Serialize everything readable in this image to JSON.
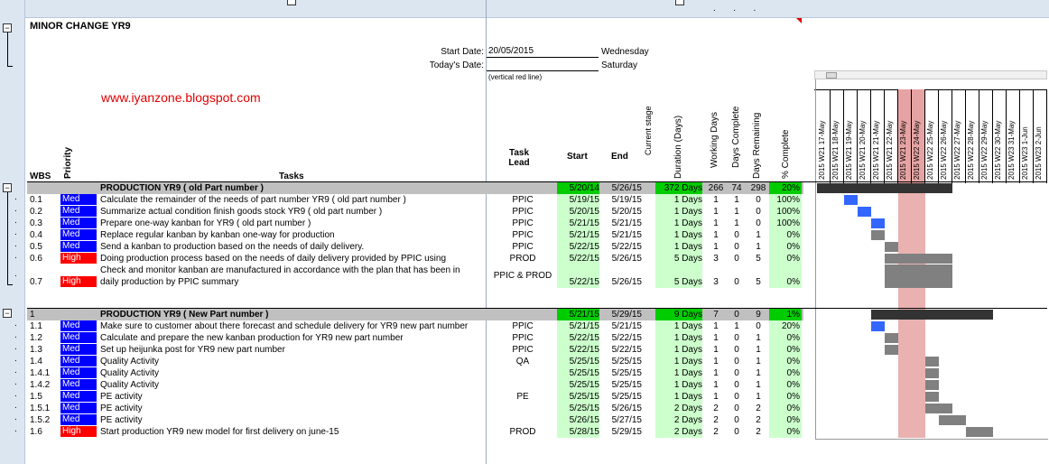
{
  "title": "MINOR CHANGE YR9",
  "start_date_label": "Start Date:",
  "start_date_value": "20/05/2015",
  "start_date_day": "Wednesday",
  "today_label": "Today's Date:",
  "today_value": "",
  "today_day": "Saturday",
  "red_line_note": "(vertical red line)",
  "watermark": "www.iyanzone.blogspot.com",
  "headers": {
    "wbs": "WBS",
    "priority": "Priority",
    "tasks": "Tasks",
    "task_lead": "Task Lead",
    "start": "Start",
    "end": "End",
    "stage": "Current stage",
    "duration": "Duration (Days)",
    "working": "Working Days",
    "complete": "Days Complete",
    "remaining": "Days Remaining",
    "pct": "% Complete"
  },
  "gantt_days": [
    {
      "date": "17-May",
      "yr": "2015",
      "wk": "W21"
    },
    {
      "date": "18-May",
      "yr": "2015",
      "wk": "W21"
    },
    {
      "date": "19-May",
      "yr": "2015",
      "wk": "W21"
    },
    {
      "date": "20-May",
      "yr": "2015",
      "wk": "W21"
    },
    {
      "date": "21-May",
      "yr": "2015",
      "wk": "W21"
    },
    {
      "date": "22-May",
      "yr": "2015",
      "wk": "W21"
    },
    {
      "date": "23-May",
      "yr": "2015",
      "wk": "W21"
    },
    {
      "date": "24-May",
      "yr": "2015",
      "wk": "W22"
    },
    {
      "date": "25-May",
      "yr": "2015",
      "wk": "W22"
    },
    {
      "date": "26-May",
      "yr": "2015",
      "wk": "W22"
    },
    {
      "date": "27-May",
      "yr": "2015",
      "wk": "W22"
    },
    {
      "date": "28-May",
      "yr": "2015",
      "wk": "W22"
    },
    {
      "date": "29-May",
      "yr": "2015",
      "wk": "W22"
    },
    {
      "date": "30-May",
      "yr": "2015",
      "wk": "W22"
    },
    {
      "date": "31-May",
      "yr": "2015",
      "wk": "W23"
    },
    {
      "date": "1-Jun",
      "yr": "2015",
      "wk": "W23"
    },
    {
      "date": "2-Jun",
      "yr": "2015",
      "wk": "W23"
    }
  ],
  "section1": {
    "task": "PRODUCTION YR9 ( old Part number )",
    "start": "5/20/14",
    "end": "5/26/15",
    "dur": "372 Days",
    "wd": "266",
    "dc": "74",
    "dr": "298",
    "pct": "20%"
  },
  "rows1": [
    {
      "wbs": "0.1",
      "pri": "Med",
      "task": "Calculate the remainder of the needs of part number YR9 ( old part number )",
      "lead": "PPIC",
      "start": "5/19/15",
      "end": "5/19/15",
      "dur": "1 Days",
      "wd": "1",
      "dc": "1",
      "dr": "0",
      "pct": "100%"
    },
    {
      "wbs": "0.2",
      "pri": "Med",
      "task": "Summarize actual condition finish goods stock YR9 ( old part number )",
      "lead": "PPIC",
      "start": "5/20/15",
      "end": "5/20/15",
      "dur": "1 Days",
      "wd": "1",
      "dc": "1",
      "dr": "0",
      "pct": "100%"
    },
    {
      "wbs": "0.3",
      "pri": "Med",
      "task": "Prepare one-way kanban for YR9 ( old part number )",
      "lead": "PPIC",
      "start": "5/21/15",
      "end": "5/21/15",
      "dur": "1 Days",
      "wd": "1",
      "dc": "1",
      "dr": "0",
      "pct": "100%"
    },
    {
      "wbs": "0.4",
      "pri": "Med",
      "task": "Replace regular kanban by kanban one-way for production",
      "lead": "PPIC",
      "start": "5/21/15",
      "end": "5/21/15",
      "dur": "1 Days",
      "wd": "1",
      "dc": "0",
      "dr": "1",
      "pct": "0%"
    },
    {
      "wbs": "0.5",
      "pri": "Med",
      "task": "Send a kanban to production based on the needs of daily delivery.",
      "lead": "PPIC",
      "start": "5/22/15",
      "end": "5/22/15",
      "dur": "1 Days",
      "wd": "1",
      "dc": "0",
      "dr": "1",
      "pct": "0%"
    },
    {
      "wbs": "0.6",
      "pri": "High",
      "task": "Doing production process based on the needs of daily delivery provided by PPIC using",
      "lead": "PROD",
      "start": "5/22/15",
      "end": "5/26/15",
      "dur": "5 Days",
      "wd": "3",
      "dc": "0",
      "dr": "5",
      "pct": "0%"
    }
  ],
  "row07": {
    "wbs": "0.7",
    "pri": "High",
    "task1": "Check and monitor kanban are manufactured in accordance with the plan that has been in",
    "task2": "daily production by PPIC summary",
    "lead": "PPIC & PROD",
    "start": "5/22/15",
    "end": "5/26/15",
    "dur": "5 Days",
    "wd": "3",
    "dc": "0",
    "dr": "5",
    "pct": "0%"
  },
  "section2": {
    "wbs": "1",
    "task": "PRODUCTION YR9 ( New Part number )",
    "start": "5/21/15",
    "end": "5/29/15",
    "dur": "9 Days",
    "wd": "7",
    "dc": "0",
    "dr": "9",
    "pct": "1%"
  },
  "rows2": [
    {
      "wbs": "1.1",
      "pri": "Med",
      "task": "Make sure to customer about there forecast and schedule delivery for YR9 new part number",
      "lead": "PPIC",
      "start": "5/21/15",
      "end": "5/21/15",
      "dur": "1 Days",
      "wd": "1",
      "dc": "1",
      "dr": "0",
      "pct": "20%"
    },
    {
      "wbs": "1.2",
      "pri": "Med",
      "task": "Calculate and prepare the new kanban production for YR9 new part number",
      "lead": "PPIC",
      "start": "5/22/15",
      "end": "5/22/15",
      "dur": "1 Days",
      "wd": "1",
      "dc": "0",
      "dr": "1",
      "pct": "0%"
    },
    {
      "wbs": "1.3",
      "pri": "Med",
      "task": "Set up heijunka post for YR9 new part number",
      "lead": "PPIC",
      "start": "5/22/15",
      "end": "5/22/15",
      "dur": "1 Days",
      "wd": "1",
      "dc": "0",
      "dr": "1",
      "pct": "0%"
    },
    {
      "wbs": "1.4",
      "pri": "Med",
      "task": "      Quality Activity",
      "lead": "QA",
      "start": "5/25/15",
      "end": "5/25/15",
      "dur": "1 Days",
      "wd": "1",
      "dc": "0",
      "dr": "1",
      "pct": "0%"
    },
    {
      "wbs": "1.4.1",
      "pri": "Med",
      "task": "          Quality Activity",
      "lead": "",
      "start": "5/25/15",
      "end": "5/25/15",
      "dur": "1 Days",
      "wd": "1",
      "dc": "0",
      "dr": "1",
      "pct": "0%"
    },
    {
      "wbs": "1.4.2",
      "pri": "Med",
      "task": "          Quality Activity",
      "lead": "",
      "start": "5/25/15",
      "end": "5/25/15",
      "dur": "1 Days",
      "wd": "1",
      "dc": "0",
      "dr": "1",
      "pct": "0%"
    },
    {
      "wbs": "1.5",
      "pri": "Med",
      "task": "      PE activity",
      "lead": "PE",
      "start": "5/25/15",
      "end": "5/25/15",
      "dur": "1 Days",
      "wd": "1",
      "dc": "0",
      "dr": "1",
      "pct": "0%"
    },
    {
      "wbs": "1.5.1",
      "pri": "Med",
      "task": "          PE activity",
      "lead": "",
      "start": "5/25/15",
      "end": "5/26/15",
      "dur": "2 Days",
      "wd": "2",
      "dc": "0",
      "dr": "2",
      "pct": "0%"
    },
    {
      "wbs": "1.5.2",
      "pri": "Med",
      "task": "          PE activity",
      "lead": "",
      "start": "5/26/15",
      "end": "5/27/15",
      "dur": "2 Days",
      "wd": "2",
      "dc": "0",
      "dr": "2",
      "pct": "0%"
    },
    {
      "wbs": "1.6",
      "pri": "High",
      "task": "Start production YR9 new model for first delivery on june-15",
      "lead": "PROD",
      "start": "5/28/15",
      "end": "5/29/15",
      "dur": "2 Days",
      "wd": "2",
      "dc": "0",
      "dr": "2",
      "pct": "0%"
    }
  ],
  "colors": {
    "med": "#0000ff",
    "high": "#ff0000",
    "done": "#3366ff",
    "plan": "#808080",
    "summary": "#333333",
    "today": "#e6a3a3",
    "green": "#00cc00",
    "lightgreen": "#ccffcc"
  },
  "gantt_bars": [
    {
      "row": "s1",
      "from": 0,
      "to": 10,
      "kind": "summary"
    },
    {
      "row": "0.1",
      "from": 2,
      "to": 3,
      "kind": "done"
    },
    {
      "row": "0.2",
      "from": 3,
      "to": 4,
      "kind": "done"
    },
    {
      "row": "0.3",
      "from": 4,
      "to": 5,
      "kind": "done"
    },
    {
      "row": "0.4",
      "from": 4,
      "to": 5,
      "kind": "plan"
    },
    {
      "row": "0.5",
      "from": 5,
      "to": 6,
      "kind": "plan"
    },
    {
      "row": "0.6",
      "from": 5,
      "to": 10,
      "kind": "plan"
    },
    {
      "row": "0.7",
      "from": 5,
      "to": 10,
      "kind": "plan"
    },
    {
      "row": "s2",
      "from": 4,
      "to": 13,
      "kind": "summary"
    },
    {
      "row": "1.1",
      "from": 4,
      "to": 5,
      "kind": "done"
    },
    {
      "row": "1.2",
      "from": 5,
      "to": 6,
      "kind": "plan"
    },
    {
      "row": "1.3",
      "from": 5,
      "to": 6,
      "kind": "plan"
    },
    {
      "row": "1.4",
      "from": 8,
      "to": 9,
      "kind": "plan"
    },
    {
      "row": "1.4.1",
      "from": 8,
      "to": 9,
      "kind": "plan"
    },
    {
      "row": "1.4.2",
      "from": 8,
      "to": 9,
      "kind": "plan"
    },
    {
      "row": "1.5",
      "from": 8,
      "to": 9,
      "kind": "plan"
    },
    {
      "row": "1.5.1",
      "from": 8,
      "to": 10,
      "kind": "plan"
    },
    {
      "row": "1.5.2",
      "from": 9,
      "to": 11,
      "kind": "plan"
    },
    {
      "row": "1.6",
      "from": 11,
      "to": 13,
      "kind": "plan"
    }
  ]
}
